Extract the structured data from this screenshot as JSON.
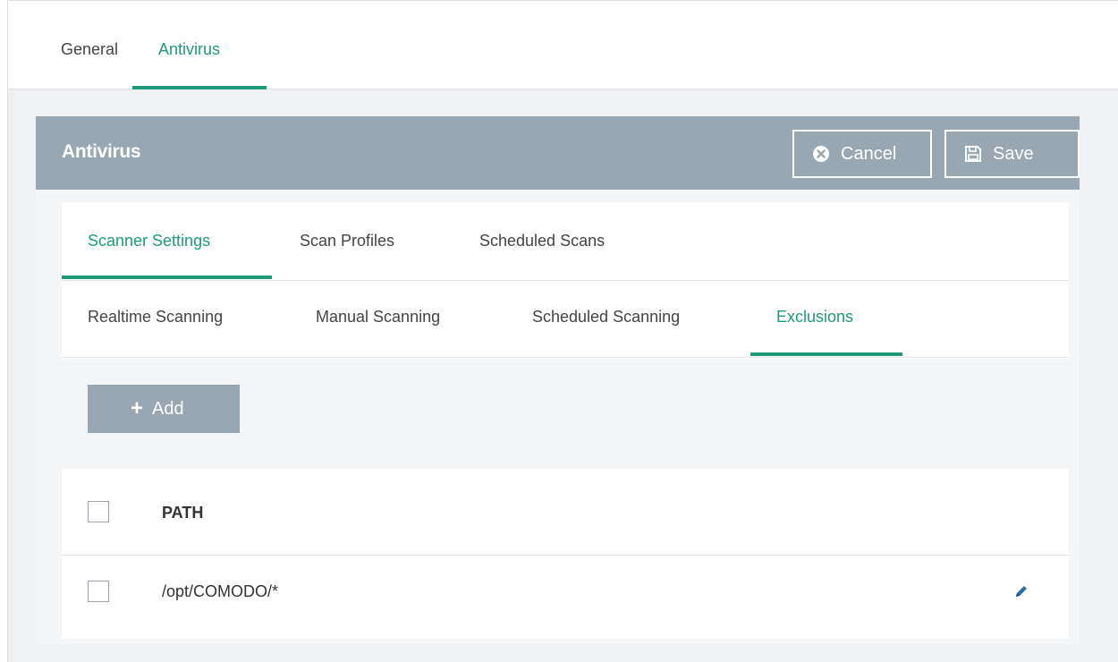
{
  "top_tabs": [
    {
      "label": "General",
      "active": false
    },
    {
      "label": "Antivirus",
      "active": true
    }
  ],
  "panel": {
    "title": "Antivirus",
    "cancel_label": "Cancel",
    "save_label": "Save"
  },
  "sub_tabs": [
    {
      "label": "Scanner Settings",
      "active": true
    },
    {
      "label": "Scan Profiles",
      "active": false
    },
    {
      "label": "Scheduled Scans",
      "active": false
    }
  ],
  "sub_tabs2": [
    {
      "label": "Realtime Scanning",
      "active": false
    },
    {
      "label": "Manual Scanning",
      "active": false
    },
    {
      "label": "Scheduled Scanning",
      "active": false
    },
    {
      "label": "Exclusions",
      "active": true
    }
  ],
  "add_label": "Add",
  "table": {
    "columns": [
      "PATH"
    ],
    "rows": [
      {
        "path": "/opt/COMODO/*"
      }
    ]
  },
  "icons": {
    "cancel": "close-circle-icon",
    "save": "floppy-disk-icon",
    "add": "plus-icon",
    "edit": "pencil-icon"
  },
  "colors": {
    "accent": "#1e9a78",
    "header_bg": "#98a7b1"
  }
}
